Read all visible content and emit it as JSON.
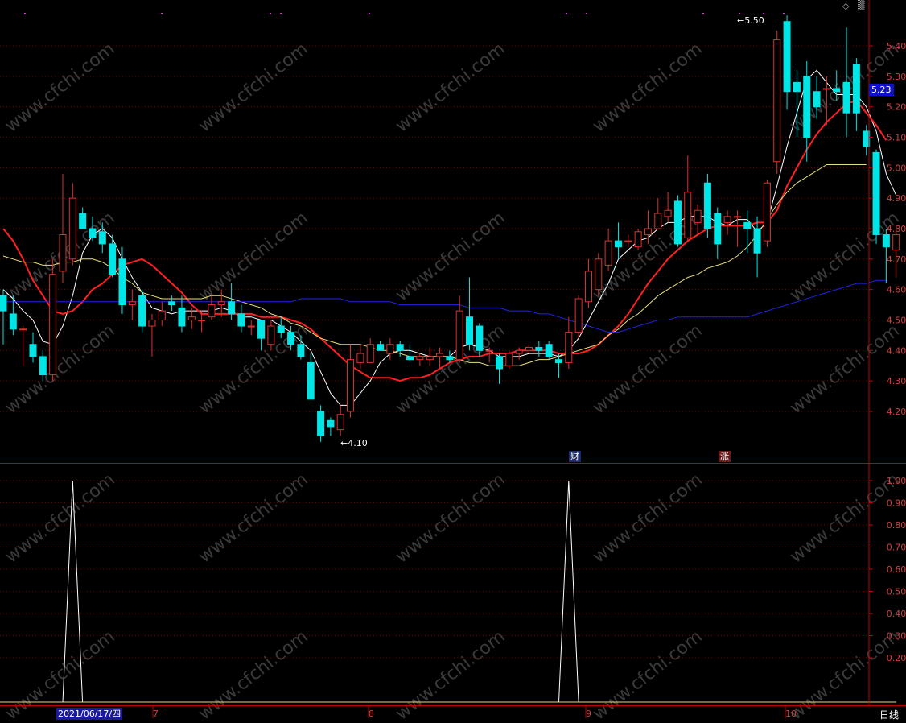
{
  "colors": {
    "bg": "#000000",
    "up": "#e03030",
    "down": "#00e5e5",
    "ma5": "#ffffff",
    "ma10": "#ff2020",
    "ma20": "#e6e07a",
    "ma60": "#2323e0",
    "axis": "#c00000",
    "grid": "#7a0000",
    "axis_text": "#d04040",
    "ind_line": "#ffffff",
    "ind_base": "#e6e07a",
    "watermark": "#2a2a2a"
  },
  "ui": {
    "period_label": "日线",
    "current_price": "5.23",
    "cursor_date": "2021/06/17/四",
    "month_labels": [
      "7",
      "8",
      "9",
      "10"
    ],
    "event_labels": {
      "finance": "财",
      "rise": "涨"
    },
    "high_label": "5.50",
    "low_label": "4.10",
    "watermark_text": "www.cfchi.com",
    "top_icons": {
      "diamond": "◇",
      "scroll": "▒"
    }
  },
  "chart_data": [
    {
      "type": "candlestick",
      "title": "",
      "y_ticks": [
        "5.40",
        "5.30",
        "5.20",
        "5.10",
        "5.00",
        "4.90",
        "4.80",
        "4.70",
        "4.60",
        "4.50",
        "4.40",
        "4.30",
        "4.20"
      ],
      "ylim": [
        4.06,
        5.51
      ],
      "candles": [
        {
          "o": 4.58,
          "h": 4.6,
          "l": 4.42,
          "c": 4.53
        },
        {
          "o": 4.52,
          "h": 4.58,
          "l": 4.45,
          "c": 4.47
        },
        {
          "o": 4.47,
          "h": 4.48,
          "l": 4.35,
          "c": 4.47
        },
        {
          "o": 4.42,
          "h": 4.46,
          "l": 4.36,
          "c": 4.38
        },
        {
          "o": 4.38,
          "h": 4.4,
          "l": 4.3,
          "c": 4.32
        },
        {
          "o": 4.32,
          "h": 4.7,
          "l": 4.3,
          "c": 4.65
        },
        {
          "o": 4.66,
          "h": 4.98,
          "l": 4.62,
          "c": 4.78
        },
        {
          "o": 4.7,
          "h": 4.95,
          "l": 4.68,
          "c": 4.9
        },
        {
          "o": 4.85,
          "h": 4.87,
          "l": 4.8,
          "c": 4.8
        },
        {
          "o": 4.8,
          "h": 4.84,
          "l": 4.76,
          "c": 4.77
        },
        {
          "o": 4.79,
          "h": 4.82,
          "l": 4.72,
          "c": 4.75
        },
        {
          "o": 4.75,
          "h": 4.78,
          "l": 4.64,
          "c": 4.65
        },
        {
          "o": 4.7,
          "h": 4.74,
          "l": 4.52,
          "c": 4.55
        },
        {
          "o": 4.55,
          "h": 4.6,
          "l": 4.5,
          "c": 4.56
        },
        {
          "o": 4.58,
          "h": 4.6,
          "l": 4.46,
          "c": 4.48
        },
        {
          "o": 4.48,
          "h": 4.52,
          "l": 4.38,
          "c": 4.5
        },
        {
          "o": 4.5,
          "h": 4.56,
          "l": 4.48,
          "c": 4.53
        },
        {
          "o": 4.56,
          "h": 4.58,
          "l": 4.53,
          "c": 4.55
        },
        {
          "o": 4.54,
          "h": 4.58,
          "l": 4.46,
          "c": 4.48
        },
        {
          "o": 4.5,
          "h": 4.54,
          "l": 4.47,
          "c": 4.51
        },
        {
          "o": 4.5,
          "h": 4.53,
          "l": 4.46,
          "c": 4.5
        },
        {
          "o": 4.51,
          "h": 4.58,
          "l": 4.5,
          "c": 4.55
        },
        {
          "o": 4.55,
          "h": 4.6,
          "l": 4.51,
          "c": 4.56
        },
        {
          "o": 4.56,
          "h": 4.62,
          "l": 4.5,
          "c": 4.52
        },
        {
          "o": 4.52,
          "h": 4.55,
          "l": 4.46,
          "c": 4.48
        },
        {
          "o": 4.48,
          "h": 4.5,
          "l": 4.45,
          "c": 4.48
        },
        {
          "o": 4.5,
          "h": 4.5,
          "l": 4.4,
          "c": 4.44
        },
        {
          "o": 4.42,
          "h": 4.5,
          "l": 4.4,
          "c": 4.48
        },
        {
          "o": 4.48,
          "h": 4.51,
          "l": 4.44,
          "c": 4.46
        },
        {
          "o": 4.46,
          "h": 4.48,
          "l": 4.4,
          "c": 4.42
        },
        {
          "o": 4.42,
          "h": 4.45,
          "l": 4.37,
          "c": 4.38
        },
        {
          "o": 4.36,
          "h": 4.39,
          "l": 4.24,
          "c": 4.24
        },
        {
          "o": 4.2,
          "h": 4.22,
          "l": 4.1,
          "c": 4.12
        },
        {
          "o": 4.17,
          "h": 4.18,
          "l": 4.12,
          "c": 4.15
        },
        {
          "o": 4.14,
          "h": 4.22,
          "l": 4.12,
          "c": 4.19
        },
        {
          "o": 4.2,
          "h": 4.42,
          "l": 4.18,
          "c": 4.37
        },
        {
          "o": 4.36,
          "h": 4.42,
          "l": 4.34,
          "c": 4.39
        },
        {
          "o": 4.36,
          "h": 4.44,
          "l": 4.36,
          "c": 4.42
        },
        {
          "o": 4.42,
          "h": 4.43,
          "l": 4.4,
          "c": 4.4
        },
        {
          "o": 4.39,
          "h": 4.44,
          "l": 4.37,
          "c": 4.42
        },
        {
          "o": 4.42,
          "h": 4.43,
          "l": 4.38,
          "c": 4.4
        },
        {
          "o": 4.38,
          "h": 4.42,
          "l": 4.36,
          "c": 4.37
        },
        {
          "o": 4.37,
          "h": 4.39,
          "l": 4.35,
          "c": 4.38
        },
        {
          "o": 4.37,
          "h": 4.41,
          "l": 4.35,
          "c": 4.38
        },
        {
          "o": 4.38,
          "h": 4.41,
          "l": 4.34,
          "c": 4.39
        },
        {
          "o": 4.38,
          "h": 4.4,
          "l": 4.36,
          "c": 4.37
        },
        {
          "o": 4.37,
          "h": 4.58,
          "l": 4.36,
          "c": 4.53
        },
        {
          "o": 4.51,
          "h": 4.64,
          "l": 4.4,
          "c": 4.42
        },
        {
          "o": 4.48,
          "h": 4.49,
          "l": 4.38,
          "c": 4.4
        },
        {
          "o": 4.4,
          "h": 4.41,
          "l": 4.36,
          "c": 4.4
        },
        {
          "o": 4.38,
          "h": 4.39,
          "l": 4.29,
          "c": 4.34
        },
        {
          "o": 4.35,
          "h": 4.4,
          "l": 4.34,
          "c": 4.39
        },
        {
          "o": 4.39,
          "h": 4.41,
          "l": 4.37,
          "c": 4.4
        },
        {
          "o": 4.4,
          "h": 4.42,
          "l": 4.39,
          "c": 4.41
        },
        {
          "o": 4.41,
          "h": 4.43,
          "l": 4.38,
          "c": 4.4
        },
        {
          "o": 4.42,
          "h": 4.43,
          "l": 4.37,
          "c": 4.38
        },
        {
          "o": 4.37,
          "h": 4.39,
          "l": 4.31,
          "c": 4.36
        },
        {
          "o": 4.36,
          "h": 4.51,
          "l": 4.34,
          "c": 4.46
        },
        {
          "o": 4.46,
          "h": 4.58,
          "l": 4.44,
          "c": 4.57
        },
        {
          "o": 4.56,
          "h": 4.7,
          "l": 4.54,
          "c": 4.66
        },
        {
          "o": 4.6,
          "h": 4.72,
          "l": 4.58,
          "c": 4.7
        },
        {
          "o": 4.68,
          "h": 4.8,
          "l": 4.66,
          "c": 4.76
        },
        {
          "o": 4.76,
          "h": 4.82,
          "l": 4.7,
          "c": 4.74
        },
        {
          "o": 4.76,
          "h": 4.78,
          "l": 4.74,
          "c": 4.76
        },
        {
          "o": 4.74,
          "h": 4.8,
          "l": 4.73,
          "c": 4.79
        },
        {
          "o": 4.78,
          "h": 4.86,
          "l": 4.75,
          "c": 4.8
        },
        {
          "o": 4.8,
          "h": 4.9,
          "l": 4.8,
          "c": 4.85
        },
        {
          "o": 4.84,
          "h": 4.92,
          "l": 4.82,
          "c": 4.86
        },
        {
          "o": 4.89,
          "h": 4.91,
          "l": 4.74,
          "c": 4.75
        },
        {
          "o": 4.77,
          "h": 5.04,
          "l": 4.76,
          "c": 4.92
        },
        {
          "o": 4.82,
          "h": 4.88,
          "l": 4.78,
          "c": 4.86
        },
        {
          "o": 4.95,
          "h": 4.98,
          "l": 4.77,
          "c": 4.8
        },
        {
          "o": 4.85,
          "h": 4.87,
          "l": 4.7,
          "c": 4.75
        },
        {
          "o": 4.82,
          "h": 4.86,
          "l": 4.78,
          "c": 4.84
        },
        {
          "o": 4.84,
          "h": 4.86,
          "l": 4.74,
          "c": 4.84
        },
        {
          "o": 4.82,
          "h": 4.86,
          "l": 4.72,
          "c": 4.8
        },
        {
          "o": 4.8,
          "h": 4.84,
          "l": 4.64,
          "c": 4.72
        },
        {
          "o": 4.76,
          "h": 4.96,
          "l": 4.74,
          "c": 4.95
        },
        {
          "o": 5.02,
          "h": 5.45,
          "l": 4.98,
          "c": 5.42
        },
        {
          "o": 5.48,
          "h": 5.5,
          "l": 5.19,
          "c": 5.25
        },
        {
          "o": 5.28,
          "h": 5.32,
          "l": 5.1,
          "c": 5.25
        },
        {
          "o": 5.3,
          "h": 5.35,
          "l": 5.02,
          "c": 5.1
        },
        {
          "o": 5.25,
          "h": 5.3,
          "l": 5.16,
          "c": 5.2
        },
        {
          "o": 5.26,
          "h": 5.3,
          "l": 5.14,
          "c": 5.26
        },
        {
          "o": 5.26,
          "h": 5.32,
          "l": 5.22,
          "c": 5.25
        },
        {
          "o": 5.28,
          "h": 5.46,
          "l": 5.1,
          "c": 5.18
        },
        {
          "o": 5.34,
          "h": 5.36,
          "l": 5.12,
          "c": 5.18
        },
        {
          "o": 5.12,
          "h": 5.14,
          "l": 5.04,
          "c": 5.07
        },
        {
          "o": 5.05,
          "h": 5.06,
          "l": 4.75,
          "c": 4.78
        },
        {
          "o": 4.78,
          "h": 4.8,
          "l": 4.62,
          "c": 4.74
        },
        {
          "o": 4.73,
          "h": 4.8,
          "l": 4.64,
          "c": 4.78
        }
      ],
      "ma_series": [
        {
          "key": "ma5",
          "values": [
            4.6,
            4.57,
            4.53,
            4.5,
            4.43,
            4.42,
            4.48,
            4.58,
            4.72,
            4.78,
            4.8,
            4.77,
            4.7,
            4.64,
            4.59,
            4.54,
            4.53,
            4.52,
            4.53,
            4.53,
            4.53,
            4.53,
            4.54,
            4.53,
            4.51,
            4.51,
            4.5,
            4.5,
            4.48,
            4.46,
            4.43,
            4.4,
            4.33,
            4.26,
            4.22,
            4.22,
            4.26,
            4.3,
            4.36,
            4.39,
            4.4,
            4.4,
            4.39,
            4.38,
            4.38,
            4.38,
            4.41,
            4.42,
            4.41,
            4.4,
            4.38,
            4.38,
            4.38,
            4.39,
            4.39,
            4.39,
            4.38,
            4.4,
            4.44,
            4.5,
            4.56,
            4.62,
            4.7,
            4.73,
            4.76,
            4.77,
            4.8,
            4.82,
            4.82,
            4.84,
            4.84,
            4.84,
            4.82,
            4.81,
            4.83,
            4.83,
            4.79,
            4.82,
            4.94,
            5.07,
            5.18,
            5.29,
            5.32,
            5.28,
            5.24,
            5.24,
            5.24,
            5.2,
            5.12,
            4.98,
            4.91
          ]
        },
        {
          "key": "ma10",
          "values": [
            4.8,
            4.76,
            4.7,
            4.63,
            4.58,
            4.53,
            4.52,
            4.53,
            4.56,
            4.6,
            4.62,
            4.65,
            4.68,
            4.69,
            4.7,
            4.68,
            4.65,
            4.62,
            4.59,
            4.55,
            4.52,
            4.52,
            4.52,
            4.52,
            4.52,
            4.52,
            4.51,
            4.51,
            4.51,
            4.5,
            4.49,
            4.47,
            4.44,
            4.41,
            4.38,
            4.35,
            4.33,
            4.31,
            4.31,
            4.31,
            4.3,
            4.31,
            4.31,
            4.32,
            4.34,
            4.36,
            4.37,
            4.38,
            4.38,
            4.39,
            4.39,
            4.39,
            4.4,
            4.4,
            4.4,
            4.4,
            4.39,
            4.39,
            4.39,
            4.4,
            4.42,
            4.45,
            4.48,
            4.52,
            4.57,
            4.62,
            4.66,
            4.7,
            4.73,
            4.76,
            4.78,
            4.8,
            4.81,
            4.81,
            4.81,
            4.81,
            4.82,
            4.82,
            4.86,
            4.94,
            5.0,
            5.06,
            5.11,
            5.15,
            5.18,
            5.21,
            5.22,
            5.18,
            5.14,
            5.09
          ]
        },
        {
          "key": "ma20",
          "values": [
            4.71,
            4.7,
            4.69,
            4.69,
            4.68,
            4.68,
            4.69,
            4.69,
            4.7,
            4.7,
            4.69,
            4.67,
            4.64,
            4.62,
            4.59,
            4.58,
            4.57,
            4.57,
            4.57,
            4.57,
            4.57,
            4.58,
            4.58,
            4.57,
            4.56,
            4.55,
            4.54,
            4.52,
            4.51,
            4.49,
            4.48,
            4.46,
            4.44,
            4.43,
            4.42,
            4.42,
            4.42,
            4.41,
            4.4,
            4.4,
            4.39,
            4.38,
            4.38,
            4.38,
            4.38,
            4.38,
            4.37,
            4.36,
            4.36,
            4.35,
            4.35,
            4.35,
            4.35,
            4.36,
            4.37,
            4.37,
            4.38,
            4.39,
            4.4,
            4.41,
            4.42,
            4.45,
            4.47,
            4.5,
            4.52,
            4.55,
            4.58,
            4.6,
            4.62,
            4.64,
            4.65,
            4.67,
            4.68,
            4.69,
            4.71,
            4.74,
            4.78,
            4.83,
            4.88,
            4.92,
            4.95,
            4.97,
            4.99,
            5.01,
            5.01,
            5.01,
            5.01,
            5.01
          ]
        },
        {
          "key": "ma60",
          "values": [
            4.56,
            4.56,
            4.56,
            4.56,
            4.56,
            4.56,
            4.56,
            4.56,
            4.56,
            4.56,
            4.56,
            4.56,
            4.56,
            4.56,
            4.56,
            4.56,
            4.56,
            4.56,
            4.56,
            4.56,
            4.56,
            4.56,
            4.56,
            4.56,
            4.56,
            4.56,
            4.56,
            4.56,
            4.56,
            4.56,
            4.57,
            4.57,
            4.57,
            4.57,
            4.57,
            4.56,
            4.56,
            4.56,
            4.56,
            4.56,
            4.55,
            4.55,
            4.55,
            4.55,
            4.55,
            4.55,
            4.55,
            4.54,
            4.54,
            4.54,
            4.54,
            4.53,
            4.53,
            4.53,
            4.52,
            4.52,
            4.51,
            4.5,
            4.49,
            4.48,
            4.47,
            4.46,
            4.46,
            4.47,
            4.48,
            4.49,
            4.5,
            4.5,
            4.51,
            4.51,
            4.51,
            4.51,
            4.51,
            4.51,
            4.51,
            4.51,
            4.52,
            4.53,
            4.54,
            4.55,
            4.56,
            4.57,
            4.58,
            4.59,
            4.6,
            4.61,
            4.62,
            4.62,
            4.63,
            4.63
          ]
        }
      ]
    },
    {
      "type": "line",
      "title": "",
      "y_ticks": [
        "1.00",
        "0.90",
        "0.80",
        "0.70",
        "0.60",
        "0.50",
        "0.40",
        "0.30",
        "0.20"
      ],
      "ylim": [
        0,
        1.0
      ],
      "values": [
        0,
        0,
        0,
        0,
        0,
        0,
        0,
        1,
        0,
        0,
        0,
        0,
        0,
        0,
        0,
        0,
        0,
        0,
        0,
        0,
        0,
        0,
        0,
        0,
        0,
        0,
        0,
        0,
        0,
        0,
        0,
        0,
        0,
        0,
        0,
        0,
        0,
        0,
        0,
        0,
        0,
        0,
        0,
        0,
        0,
        0,
        0,
        0,
        0,
        0,
        0,
        0,
        0,
        0,
        0,
        0,
        0,
        1,
        0,
        0,
        0,
        0,
        0,
        0,
        0,
        0,
        0,
        0,
        0,
        0,
        0,
        0,
        0,
        0,
        0,
        0,
        0,
        0,
        0,
        0,
        0,
        0,
        0,
        0,
        0,
        0,
        0,
        0,
        0,
        0,
        0
      ]
    }
  ]
}
